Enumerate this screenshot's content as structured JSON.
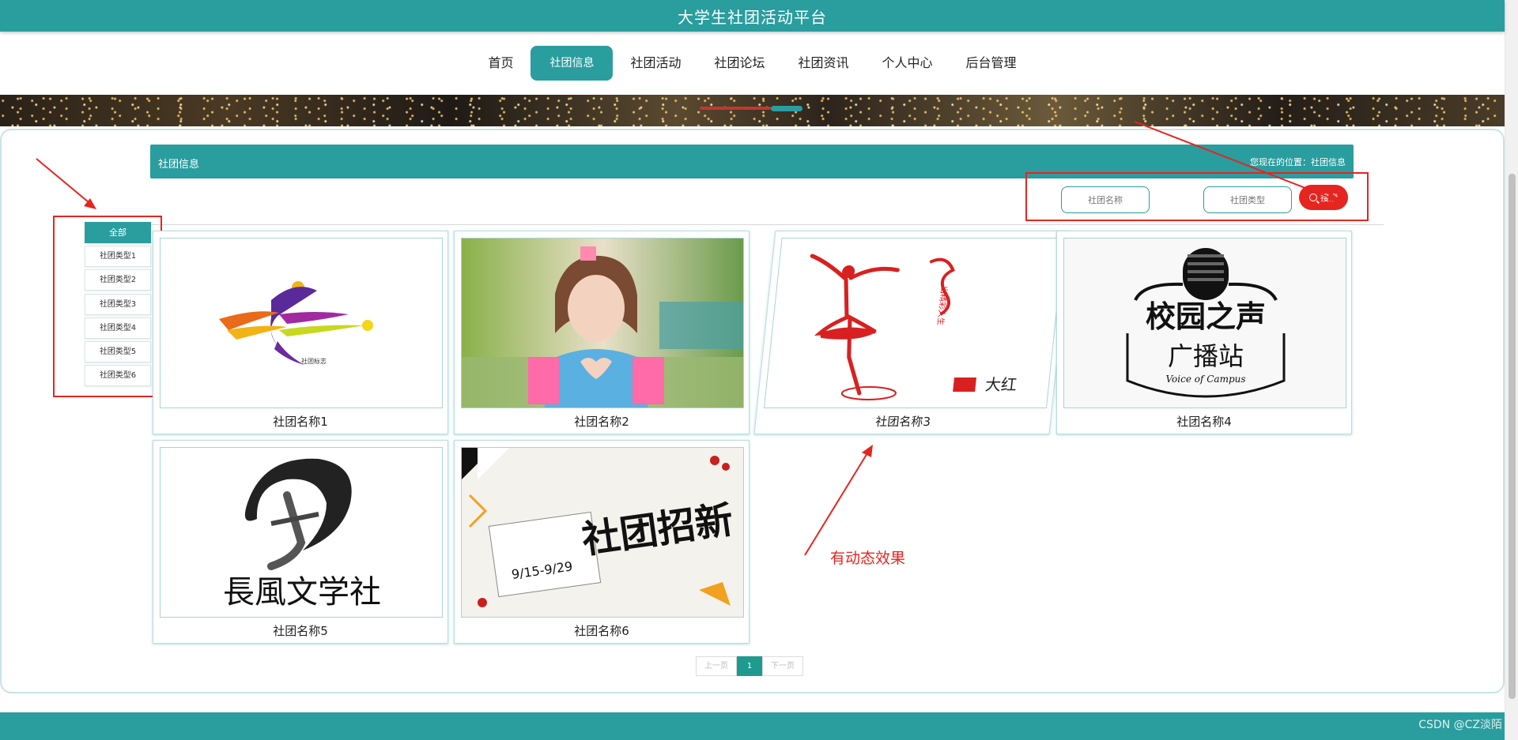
{
  "header": {
    "site_title": "大学生社团活动平台"
  },
  "nav": {
    "items": [
      {
        "label": "首页"
      },
      {
        "label": "社团信息"
      },
      {
        "label": "社团活动"
      },
      {
        "label": "社团论坛"
      },
      {
        "label": "社团资讯"
      },
      {
        "label": "个人中心"
      },
      {
        "label": "后台管理"
      }
    ],
    "active": "社团信息"
  },
  "section": {
    "title": "社团信息",
    "breadcrumb": "您现在的位置：社团信息"
  },
  "search": {
    "name_placeholder": "社团名称",
    "type_placeholder": "社团类型",
    "button_label": "搜索"
  },
  "categories": {
    "items": [
      {
        "label": "全部"
      },
      {
        "label": "社团类型1"
      },
      {
        "label": "社团类型2"
      },
      {
        "label": "社团类型3"
      },
      {
        "label": "社团类型4"
      },
      {
        "label": "社团类型5"
      },
      {
        "label": "社团类型6"
      }
    ],
    "active": "全部"
  },
  "cards": [
    {
      "name": "社团名称1",
      "logo_text": "社团标志"
    },
    {
      "name": "社团名称2",
      "logo_text": ""
    },
    {
      "name": "社团名称3",
      "logo_text": "大红"
    },
    {
      "name": "社团名称4",
      "logo_text": "校园之声",
      "logo_sub": "广播站",
      "logo_sub2": "Voice of Campus"
    },
    {
      "name": "社团名称5",
      "logo_text": "長風文学社"
    },
    {
      "name": "社团名称6",
      "logo_text": "社团招新",
      "logo_sub": "9/15-9/29"
    }
  ],
  "pagination": {
    "prev": "上一页",
    "current": "1",
    "next": "下一页"
  },
  "annotation": {
    "text": "有动态效果"
  },
  "watermark": "CSDN @CZ淡陌",
  "colors": {
    "primary": "#2a9d9f",
    "accent_red": "#e52520"
  }
}
